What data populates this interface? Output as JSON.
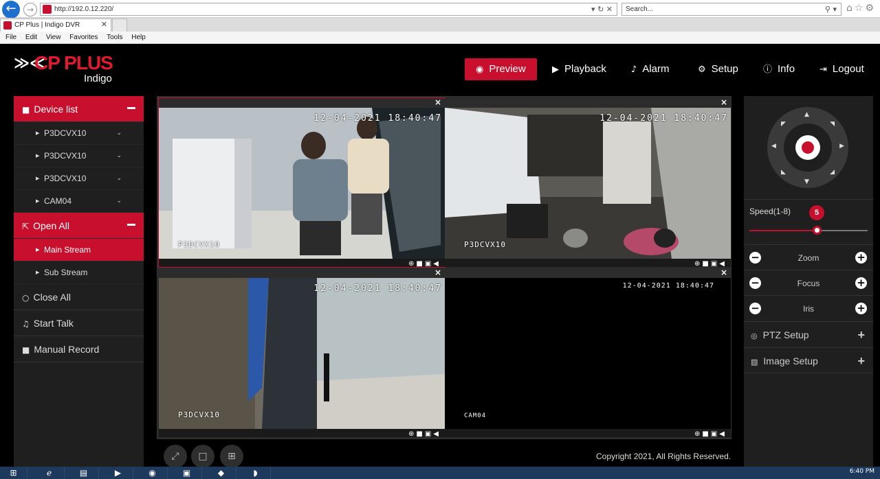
{
  "browser": {
    "url": "http://192.0.12.220/",
    "search_placeholder": "Search...",
    "tab_title": "CP Plus | Indigo DVR",
    "menu": [
      "File",
      "Edit",
      "View",
      "Favorites",
      "Tools",
      "Help"
    ]
  },
  "app": {
    "brand": "CP PLUS",
    "subbrand": "Indigo",
    "nav": {
      "preview": "Preview",
      "playback": "Playback",
      "alarm": "Alarm",
      "setup": "Setup",
      "info": "Info",
      "logout": "Logout"
    }
  },
  "sidebar": {
    "device_list": "Device list",
    "devices": [
      "P3DCVX10",
      "P3DCVX10",
      "P3DCVX10",
      "CAM04"
    ],
    "open_all": "Open All",
    "main_stream": "Main Stream",
    "sub_stream": "Sub Stream",
    "close_all": "Close All",
    "start_talk": "Start Talk",
    "manual_record": "Manual Record"
  },
  "tiles": [
    {
      "timestamp": "12-04-2021 18:40:47",
      "camera": "P3DCVX10"
    },
    {
      "timestamp": "12-04-2021 18:40:47",
      "camera": "P3DCVX10"
    },
    {
      "timestamp": "12-04-2021 18:40:47",
      "camera": "P3DCVX10"
    },
    {
      "timestamp": "12-04-2021 18:40:47",
      "camera": "CAM04"
    }
  ],
  "footer": {
    "copyright": "Copyright 2021, All Rights Reserved."
  },
  "ptz": {
    "speed_label": "Speed(1-8)",
    "speed_value": "5",
    "speed_fraction": 0.57,
    "zoom": "Zoom",
    "focus": "Focus",
    "iris": "Iris",
    "ptz_setup": "PTZ Setup",
    "image_setup": "Image Setup"
  },
  "taskbar": {
    "clock": "6:40 PM"
  },
  "colors": {
    "accent": "#c8102e",
    "background": "#000000",
    "panel": "#1f1f1f"
  }
}
